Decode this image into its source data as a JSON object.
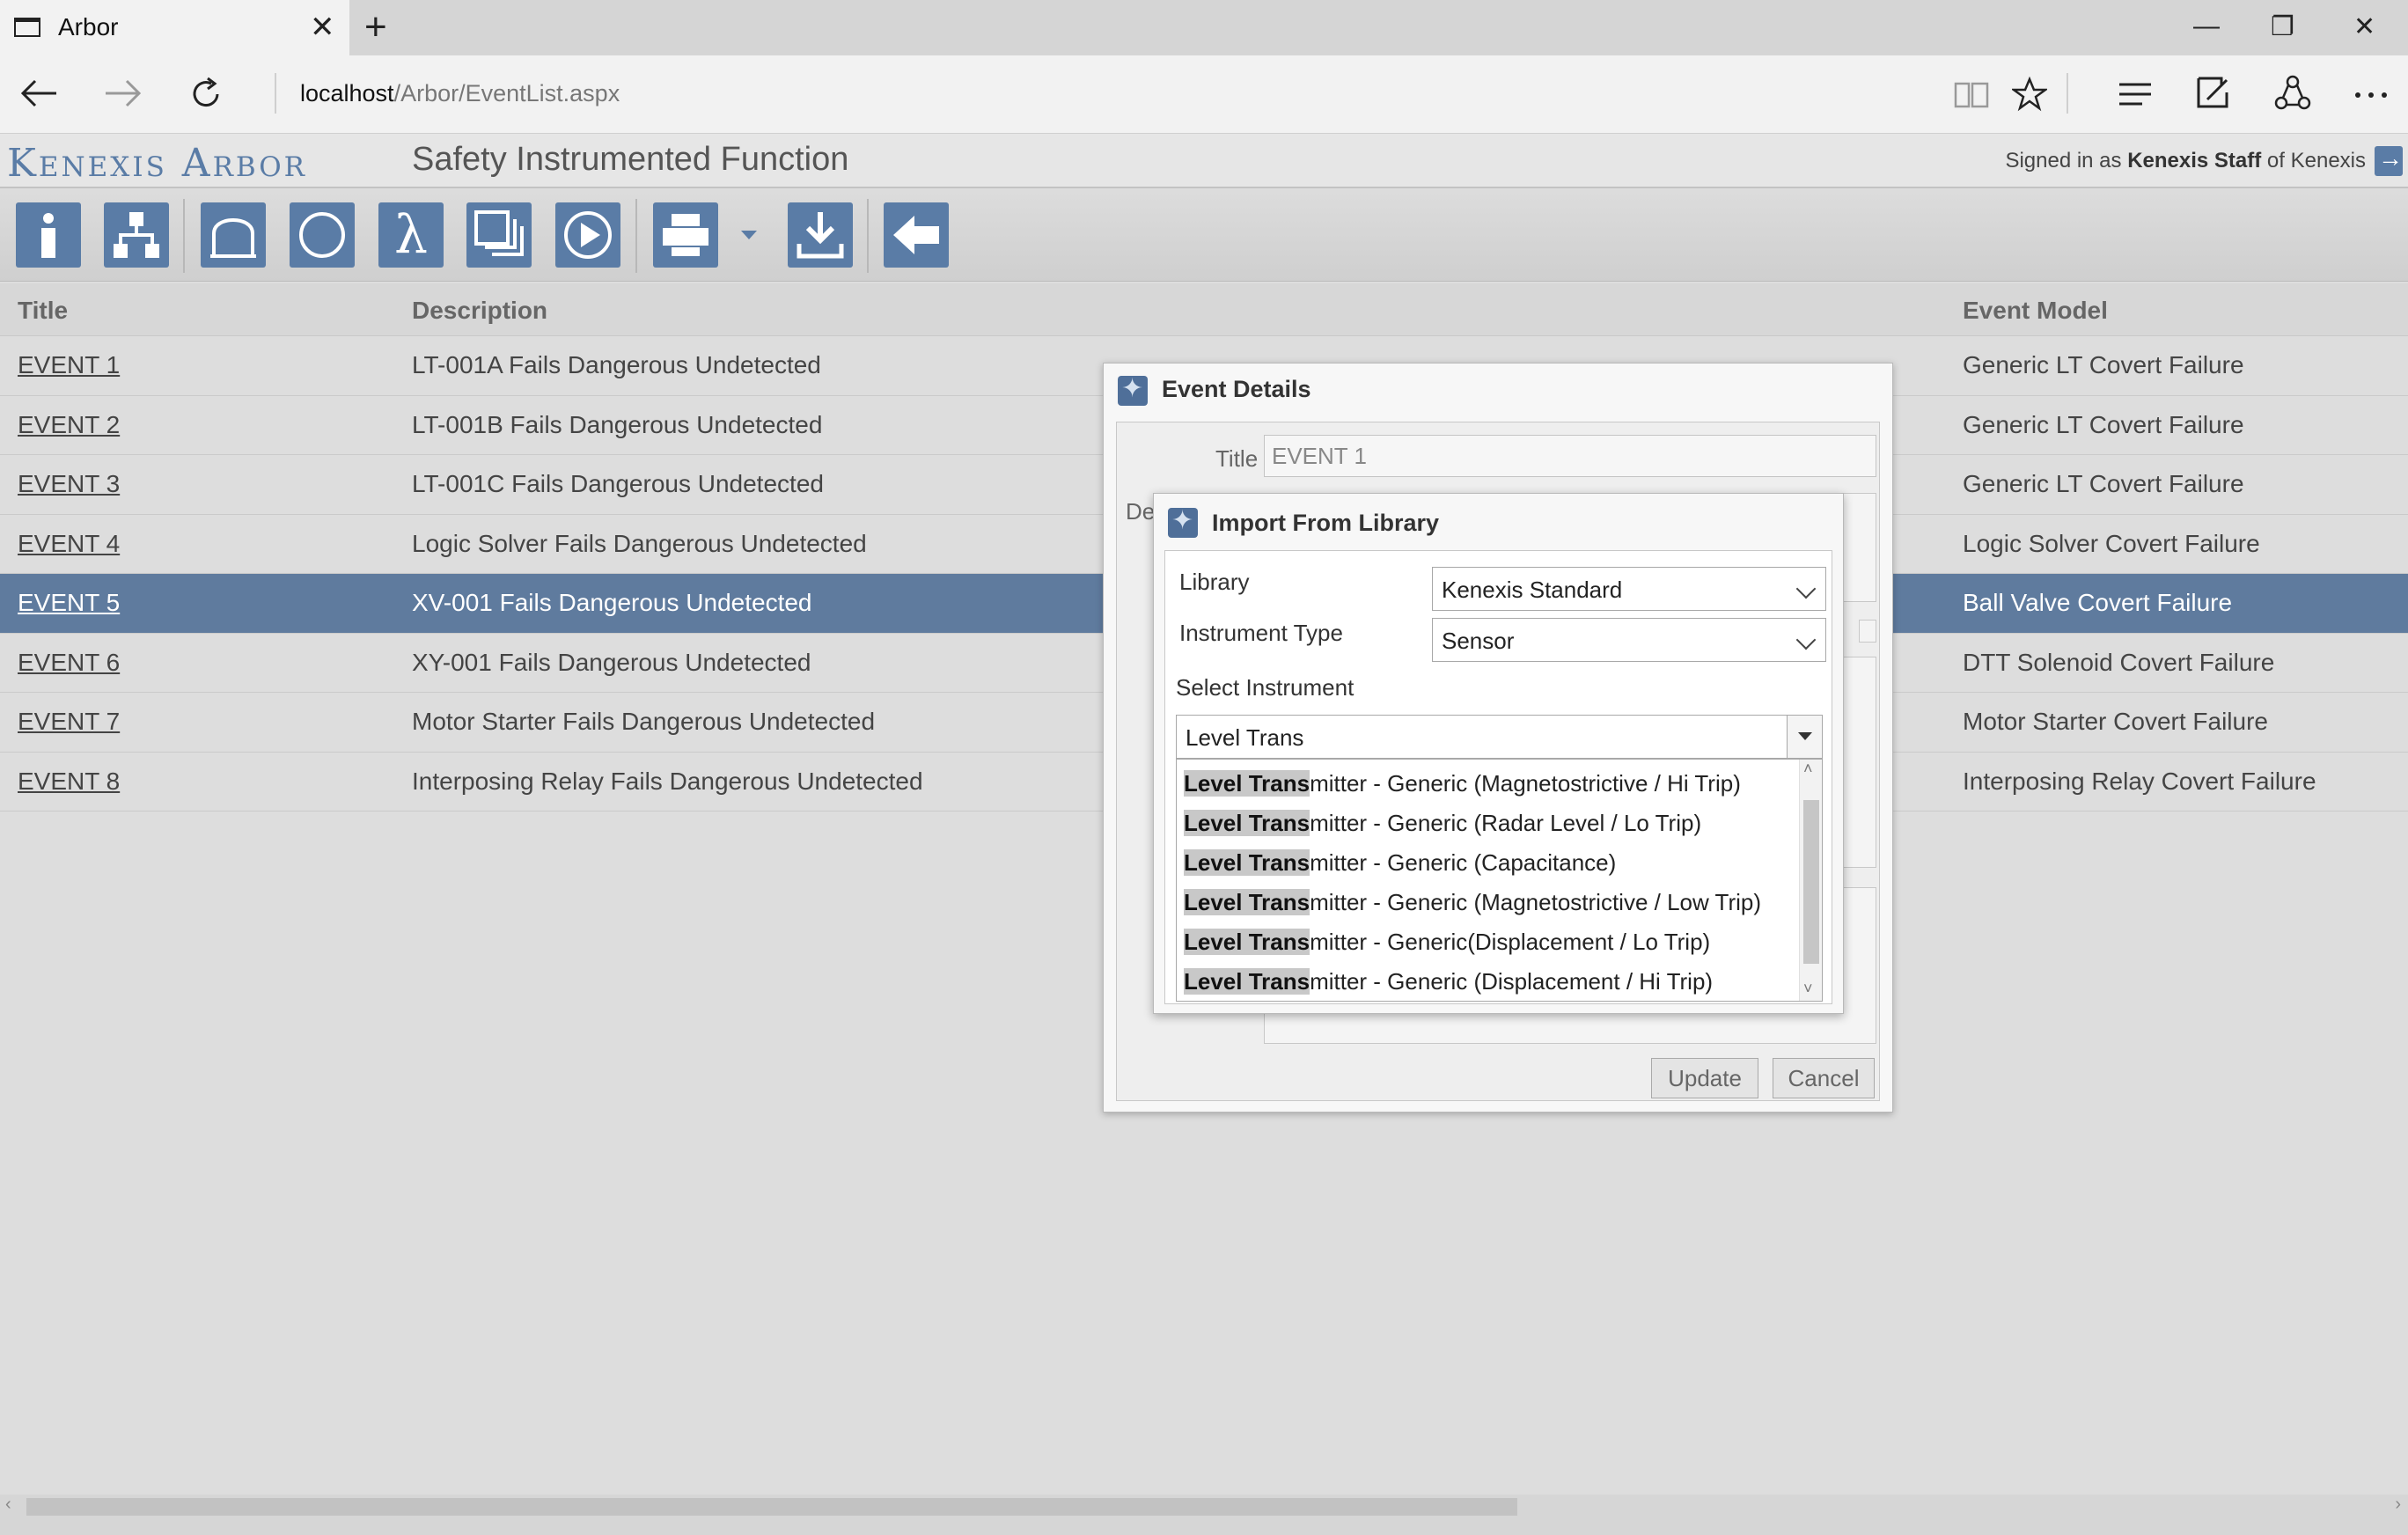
{
  "browser": {
    "tab_title": "Arbor",
    "tab_close": "✕",
    "new_tab": "+",
    "url_host": "localhost",
    "url_path": "/Arbor/EventList.aspx",
    "window_controls": {
      "minimize": "—",
      "restore": "❐",
      "close": "✕"
    }
  },
  "app": {
    "logo": "Kenexis Arbor",
    "page_title": "Safety Instrumented Function",
    "signed_prefix": "Signed in as ",
    "signed_user": "Kenexis Staff",
    "signed_suffix": " of Kenexis"
  },
  "toolbar": {
    "icons": [
      "info-icon",
      "hierarchy-icon",
      "bell-curve-icon",
      "circle-icon",
      "lambda-icon",
      "copy-icon",
      "play-icon",
      "print-icon",
      "download-icon",
      "back-arrow-icon"
    ],
    "lambda_glyph": "λ"
  },
  "table": {
    "headers": {
      "title": "Title",
      "description": "Description",
      "event_model": "Event Model"
    },
    "rows": [
      {
        "title": "EVENT 1",
        "description": "LT-001A Fails Dangerous Undetected",
        "event_model": "Generic LT Covert Failure",
        "selected": false
      },
      {
        "title": "EVENT 2",
        "description": "LT-001B Fails Dangerous Undetected",
        "event_model": "Generic LT Covert Failure",
        "selected": false
      },
      {
        "title": "EVENT 3",
        "description": "LT-001C Fails Dangerous Undetected",
        "event_model": "Generic LT Covert Failure",
        "selected": false
      },
      {
        "title": "EVENT 4",
        "description": "Logic Solver Fails Dangerous Undetected",
        "event_model": "Logic Solver Covert Failure",
        "selected": false
      },
      {
        "title": "EVENT 5",
        "description": "XV-001 Fails Dangerous Undetected",
        "event_model": "Ball Valve Covert Failure",
        "selected": true
      },
      {
        "title": "EVENT 6",
        "description": "XY-001 Fails Dangerous Undetected",
        "event_model": "DTT Solenoid Covert Failure",
        "selected": false
      },
      {
        "title": "EVENT 7",
        "description": "Motor Starter Fails Dangerous Undetected",
        "event_model": "Motor Starter Covert Failure",
        "selected": false
      },
      {
        "title": "EVENT 8",
        "description": "Interposing Relay Fails Dangerous Undetected",
        "event_model": "Interposing Relay Covert Failure",
        "selected": false
      }
    ]
  },
  "event_details": {
    "heading": "Event Details",
    "title_label": "Title",
    "title_value": "EVENT 1",
    "desc_label_partial": "De",
    "update_label": "Update",
    "cancel_label": "Cancel"
  },
  "import_dialog": {
    "heading": "Import From Library",
    "library_label": "Library",
    "library_value": "Kenexis Standard",
    "instrument_type_label": "Instrument Type",
    "instrument_type_value": "Sensor",
    "select_instrument_label": "Select Instrument",
    "search_value": "Level Trans",
    "options": [
      {
        "match": "Level Trans",
        "rest": "mitter - Generic (Magnetostrictive / Hi Trip)"
      },
      {
        "match": "Level Trans",
        "rest": "mitter - Generic (Radar Level / Lo Trip)"
      },
      {
        "match": "Level Trans",
        "rest": "mitter - Generic (Capacitance)"
      },
      {
        "match": "Level Trans",
        "rest": "mitter - Generic (Magnetostrictive / Low Trip)"
      },
      {
        "match": "Level Trans",
        "rest": "mitter - Generic(Displacement / Lo Trip)"
      },
      {
        "match": "Level Trans",
        "rest": "mitter - Generic (Displacement / Hi Trip)"
      }
    ]
  }
}
